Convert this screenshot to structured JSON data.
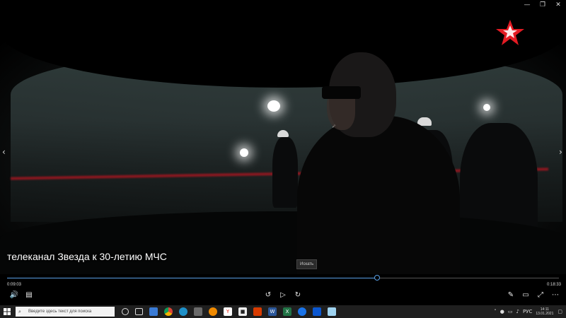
{
  "window": {
    "minimize_label": "—",
    "maximize_label": "❐",
    "close_label": "✕"
  },
  "video": {
    "title": "телеканал Звезда к 30-летию МЧС",
    "tooltip": "Искать",
    "elapsed": "0:09:03",
    "total": "0:18:33",
    "progress": 0.67
  },
  "taskbar": {
    "search_placeholder": "Введите здесь текст для поиска",
    "lang": "РУС",
    "time": "14:11",
    "date": "13.01.2021"
  },
  "icons": {
    "prev": "‹",
    "next": "›",
    "volume": "🔊",
    "captions": "▤",
    "rewind": "↺",
    "play": "▷",
    "forward": "↻",
    "edit": "✎",
    "miniview": "▭",
    "fullscreen": "⤢",
    "more": "⋯"
  },
  "colors": {
    "accent": "#5aa0e6",
    "logo_red": "#e31b23"
  }
}
